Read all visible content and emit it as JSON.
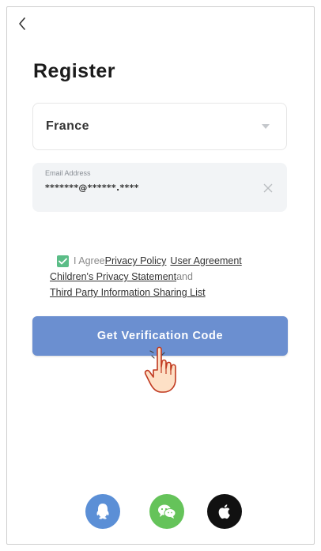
{
  "header": {
    "back_icon": "chevron-left-icon",
    "title": "Register"
  },
  "form": {
    "country": {
      "value": "France",
      "icon": "caret-down-icon"
    },
    "email": {
      "label": "Email Address",
      "value": "*******@******.****",
      "clear_icon": "close-icon"
    }
  },
  "agreement": {
    "checked": true,
    "prefix": "I Agree",
    "privacy_policy": "Privacy Policy",
    "user_agreement": "User Agreement",
    "children_privacy": "Children's Privacy Statement",
    "and": "and",
    "third_party": "Third Party Information Sharing List"
  },
  "actions": {
    "verify_label": "Get Verification Code",
    "pointer_icon": "hand-pointer-icon"
  },
  "social_login": [
    {
      "name": "qq",
      "icon": "qq-icon"
    },
    {
      "name": "wechat",
      "icon": "wechat-icon"
    },
    {
      "name": "apple",
      "icon": "apple-icon"
    }
  ],
  "colors": {
    "primary_button": "#6b8fd0",
    "checkbox": "#5bbd87",
    "qq": "#5b8fd6",
    "wechat": "#65c35a",
    "apple": "#111111"
  }
}
